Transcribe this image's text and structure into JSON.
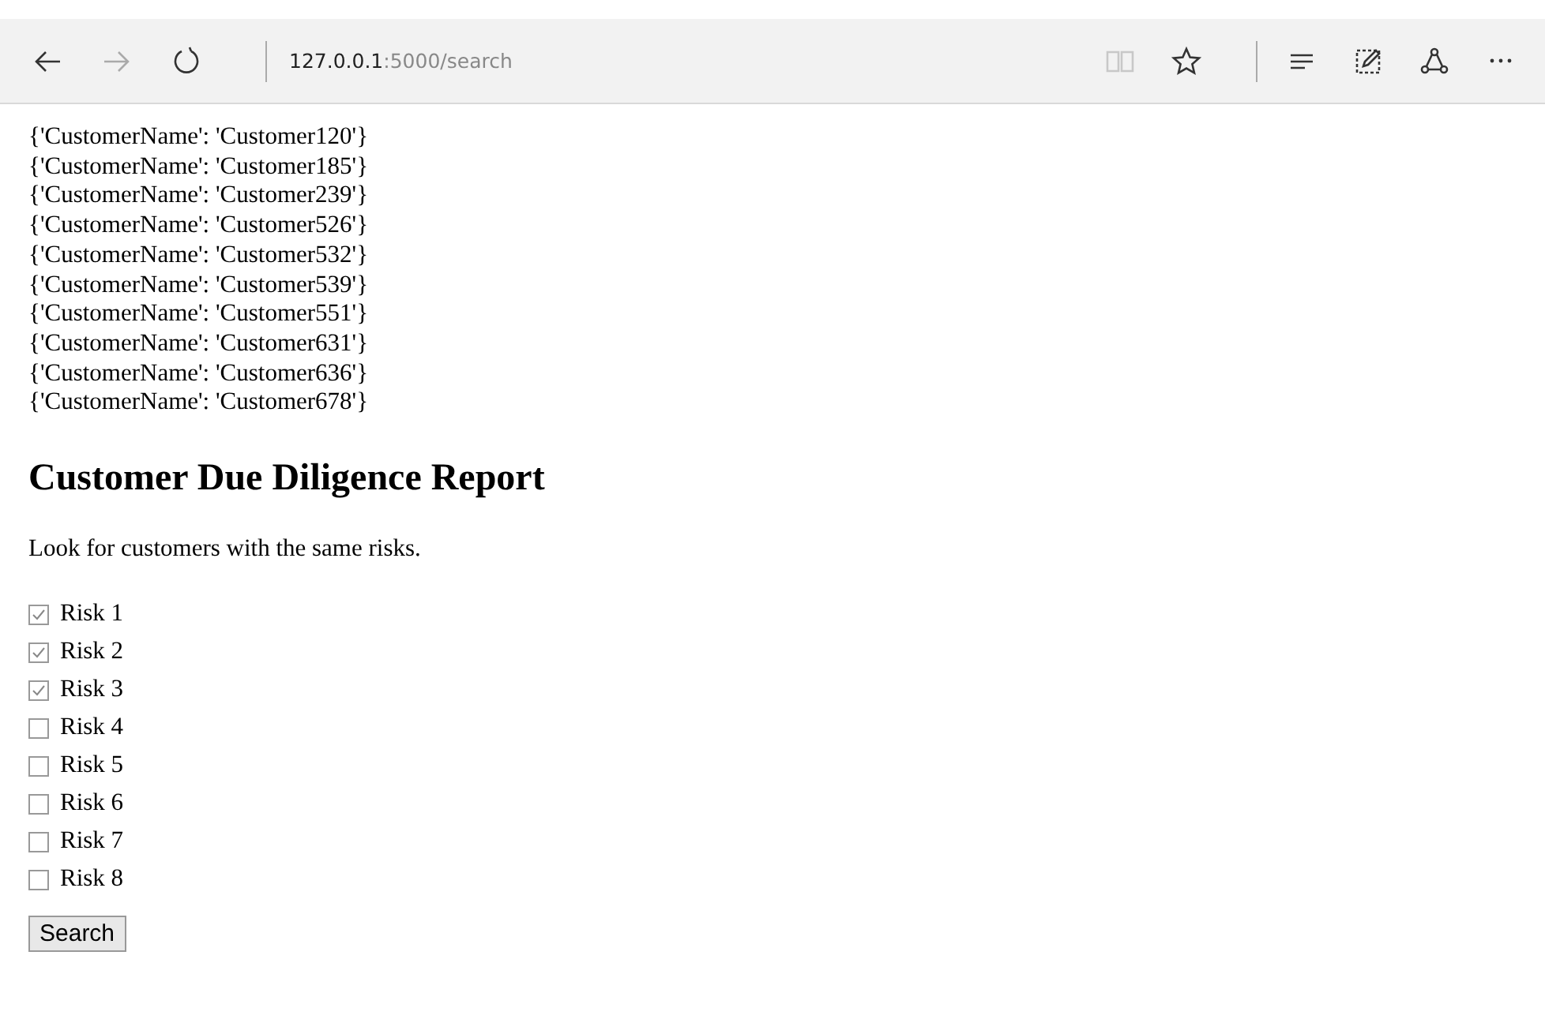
{
  "browser": {
    "address_host": "127.0.0.1",
    "address_path": ":5000/search",
    "reading_view_disabled": true
  },
  "results": [
    "{'CustomerName': 'Customer120'}",
    "{'CustomerName': 'Customer185'}",
    "{'CustomerName': 'Customer239'}",
    "{'CustomerName': 'Customer526'}",
    "{'CustomerName': 'Customer532'}",
    "{'CustomerName': 'Customer539'}",
    "{'CustomerName': 'Customer551'}",
    "{'CustomerName': 'Customer631'}",
    "{'CustomerName': 'Customer636'}",
    "{'CustomerName': 'Customer678'}"
  ],
  "heading": "Customer Due Diligence Report",
  "intro": "Look for customers with the same risks.",
  "risks": [
    {
      "label": "Risk 1",
      "checked": true
    },
    {
      "label": "Risk 2",
      "checked": true
    },
    {
      "label": "Risk 3",
      "checked": true
    },
    {
      "label": "Risk 4",
      "checked": false
    },
    {
      "label": "Risk 5",
      "checked": false
    },
    {
      "label": "Risk 6",
      "checked": false
    },
    {
      "label": "Risk 7",
      "checked": false
    },
    {
      "label": "Risk 8",
      "checked": false
    }
  ],
  "search_button": "Search"
}
